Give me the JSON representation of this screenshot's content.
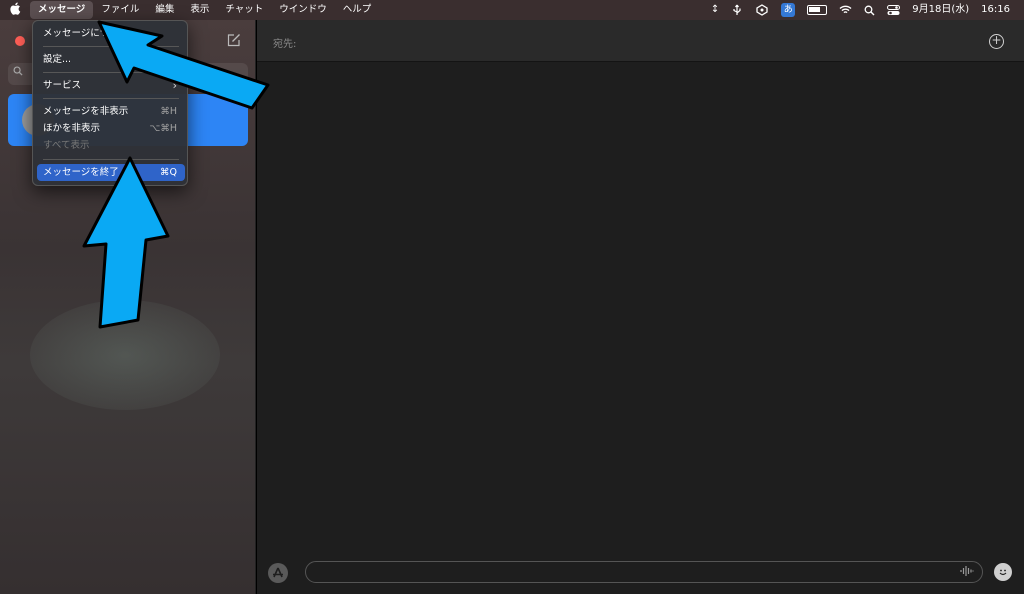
{
  "menubar": {
    "apple": "",
    "items": [
      "メッセージ",
      "ファイル",
      "編集",
      "表示",
      "チャット",
      "ウインドウ",
      "ヘルプ"
    ],
    "ime": "あ",
    "date": "9月18日(水)",
    "time": "16:16"
  },
  "dropdown": {
    "items": [
      {
        "label": "メッセージについて",
        "shortcut": ""
      },
      {
        "label": "設定...",
        "shortcut": ""
      },
      {
        "label": "サービス",
        "shortcut": "›"
      },
      {
        "label": "メッセージを非表示",
        "shortcut": "⌘H"
      },
      {
        "label": "ほかを非表示",
        "shortcut": "⌥⌘H"
      },
      {
        "label": "すべて表示",
        "shortcut": ""
      },
      {
        "label": "メッセージを終了",
        "shortcut": "⌘Q"
      }
    ]
  },
  "main": {
    "to_label": "宛先:",
    "add_symbol": "+",
    "message_placeholder": ""
  },
  "colors": {
    "accent": "#2d85f5",
    "highlight": "#2f64c9",
    "arrow": "#0aa9f4",
    "close": "#ff5f57"
  },
  "icons": [
    "apple-icon",
    "updown-arrow-icon",
    "usb-icon",
    "cloud-icon",
    "battery-icon",
    "wifi-icon",
    "search-icon",
    "control-center-icon",
    "compose-icon",
    "appstore-icon",
    "audio-wave-icon",
    "emoji-icon"
  ]
}
